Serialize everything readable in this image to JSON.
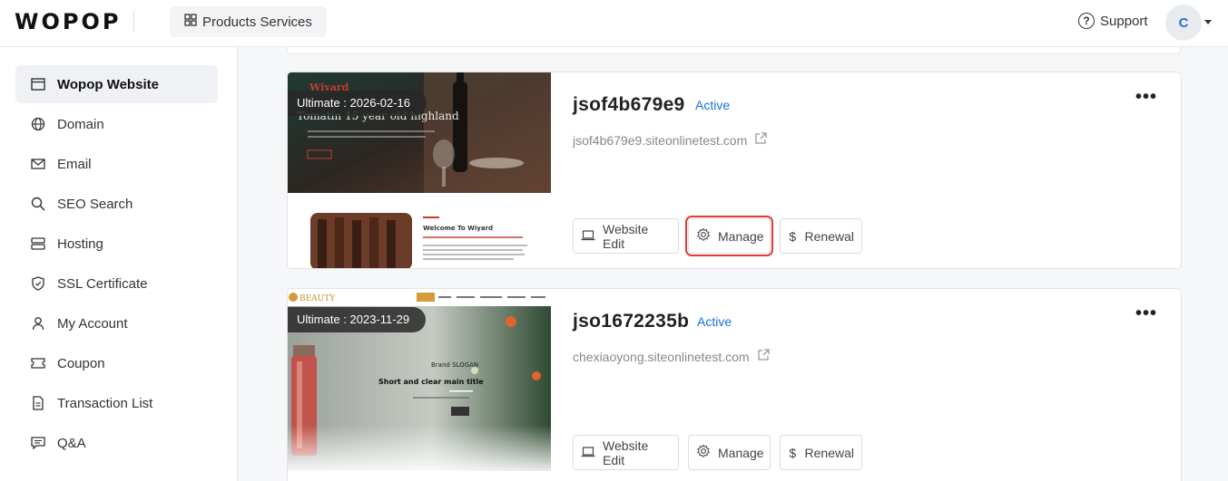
{
  "header": {
    "logo": "WOPOP",
    "products_label": "Products Services",
    "support_label": "Support",
    "avatar_letter": "C"
  },
  "sidebar": {
    "items": [
      {
        "label": "Wopop Website",
        "icon": "browser-window-icon",
        "active": true
      },
      {
        "label": "Domain",
        "icon": "globe-icon"
      },
      {
        "label": "Email",
        "icon": "envelope-icon"
      },
      {
        "label": "SEO Search",
        "icon": "search-icon"
      },
      {
        "label": "Hosting",
        "icon": "server-icon"
      },
      {
        "label": "SSL Certificate",
        "icon": "shield-icon"
      },
      {
        "label": "My Account",
        "icon": "user-icon"
      },
      {
        "label": "Coupon",
        "icon": "ticket-icon"
      },
      {
        "label": "Transaction List",
        "icon": "document-icon"
      },
      {
        "label": "Q&A",
        "icon": "chat-icon"
      }
    ]
  },
  "sites": [
    {
      "plan": "Ultimate : 2026-02-16",
      "name": "jsof4b679e9",
      "status": "Active",
      "url": "jsof4b679e9.siteonlinetest.com",
      "thumb_brand": "Wiyard",
      "thumb_headline": "Tomatin 15 year old highland",
      "thumb_welcome": "Welcome To Wiyard",
      "actions": {
        "edit": "Website Edit",
        "manage": "Manage",
        "renewal": "Renewal"
      }
    },
    {
      "plan": "Ultimate : 2023-11-29",
      "name": "jso1672235b",
      "status": "Active",
      "url": "chexiaoyong.siteonlinetest.com",
      "thumb_brand": "BEAUTY",
      "thumb_slogan": "Brand SLOGAN",
      "thumb_title": "Short and clear main title",
      "actions": {
        "edit": "Website Edit",
        "manage": "Manage",
        "renewal": "Renewal"
      }
    }
  ],
  "colors": {
    "accent": "#1a6fe0",
    "highlight": "#e03a3a"
  }
}
